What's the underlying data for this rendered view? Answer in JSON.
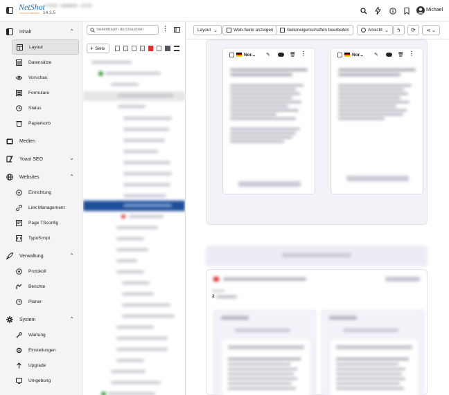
{
  "app": {
    "logo_text": "NetShot",
    "logo_sub": "TYPO3 & FLOWFUSION",
    "site_name": "TYPO3 · Backend · XXXX",
    "version": "14.3.5",
    "user_name": "Michael"
  },
  "sidebar": {
    "sections": [
      {
        "label": "Inhalt",
        "icon": "content-icon",
        "items": [
          {
            "label": "Layout",
            "icon": "layout-icon",
            "active": true
          },
          {
            "label": "Datensätze",
            "icon": "records-icon"
          },
          {
            "label": "Vorschau",
            "icon": "preview-icon"
          },
          {
            "label": "Formulare",
            "icon": "forms-icon"
          },
          {
            "label": "Status",
            "icon": "status-icon"
          },
          {
            "label": "Papierkorb",
            "icon": "trash-icon"
          }
        ]
      },
      {
        "label": "Medien",
        "icon": "media-icon",
        "items": []
      },
      {
        "label": "Yoast SEO",
        "icon": "yoast-icon",
        "items": []
      },
      {
        "label": "Websites",
        "icon": "globe-icon",
        "items": [
          {
            "label": "Einrichtung",
            "icon": "setup-icon"
          },
          {
            "label": "Link Management",
            "icon": "link-icon"
          },
          {
            "label": "Page TSconfig",
            "icon": "tsconfig-icon"
          },
          {
            "label": "TypoScript",
            "icon": "typoscript-icon"
          }
        ]
      },
      {
        "label": "Verwaltung",
        "icon": "rocket-icon",
        "items": [
          {
            "label": "Protokoll",
            "icon": "log-icon"
          },
          {
            "label": "Berichte",
            "icon": "reports-icon"
          },
          {
            "label": "Planer",
            "icon": "scheduler-icon"
          }
        ]
      },
      {
        "label": "System",
        "icon": "gear-icon",
        "items": [
          {
            "label": "Wartung",
            "icon": "maintenance-icon"
          },
          {
            "label": "Einstellungen",
            "icon": "settings-icon"
          },
          {
            "label": "Upgrade",
            "icon": "upgrade-icon"
          },
          {
            "label": "Umgebung",
            "icon": "environment-icon"
          }
        ]
      }
    ]
  },
  "tree": {
    "search_placeholder": "Seitenbaum durchsuchen",
    "new_page_label": "Seite"
  },
  "toolbar": {
    "layout_label": "Layout",
    "view_page_label": "Web-Seite anzeigen",
    "edit_props_label": "Seiteneigenschaften bearbeiten",
    "view_label": "Ansicht"
  },
  "content": {
    "card1_lang": "Nor...",
    "card2_lang": "Nor...",
    "section_label": "Sprache",
    "section_value": "2"
  }
}
